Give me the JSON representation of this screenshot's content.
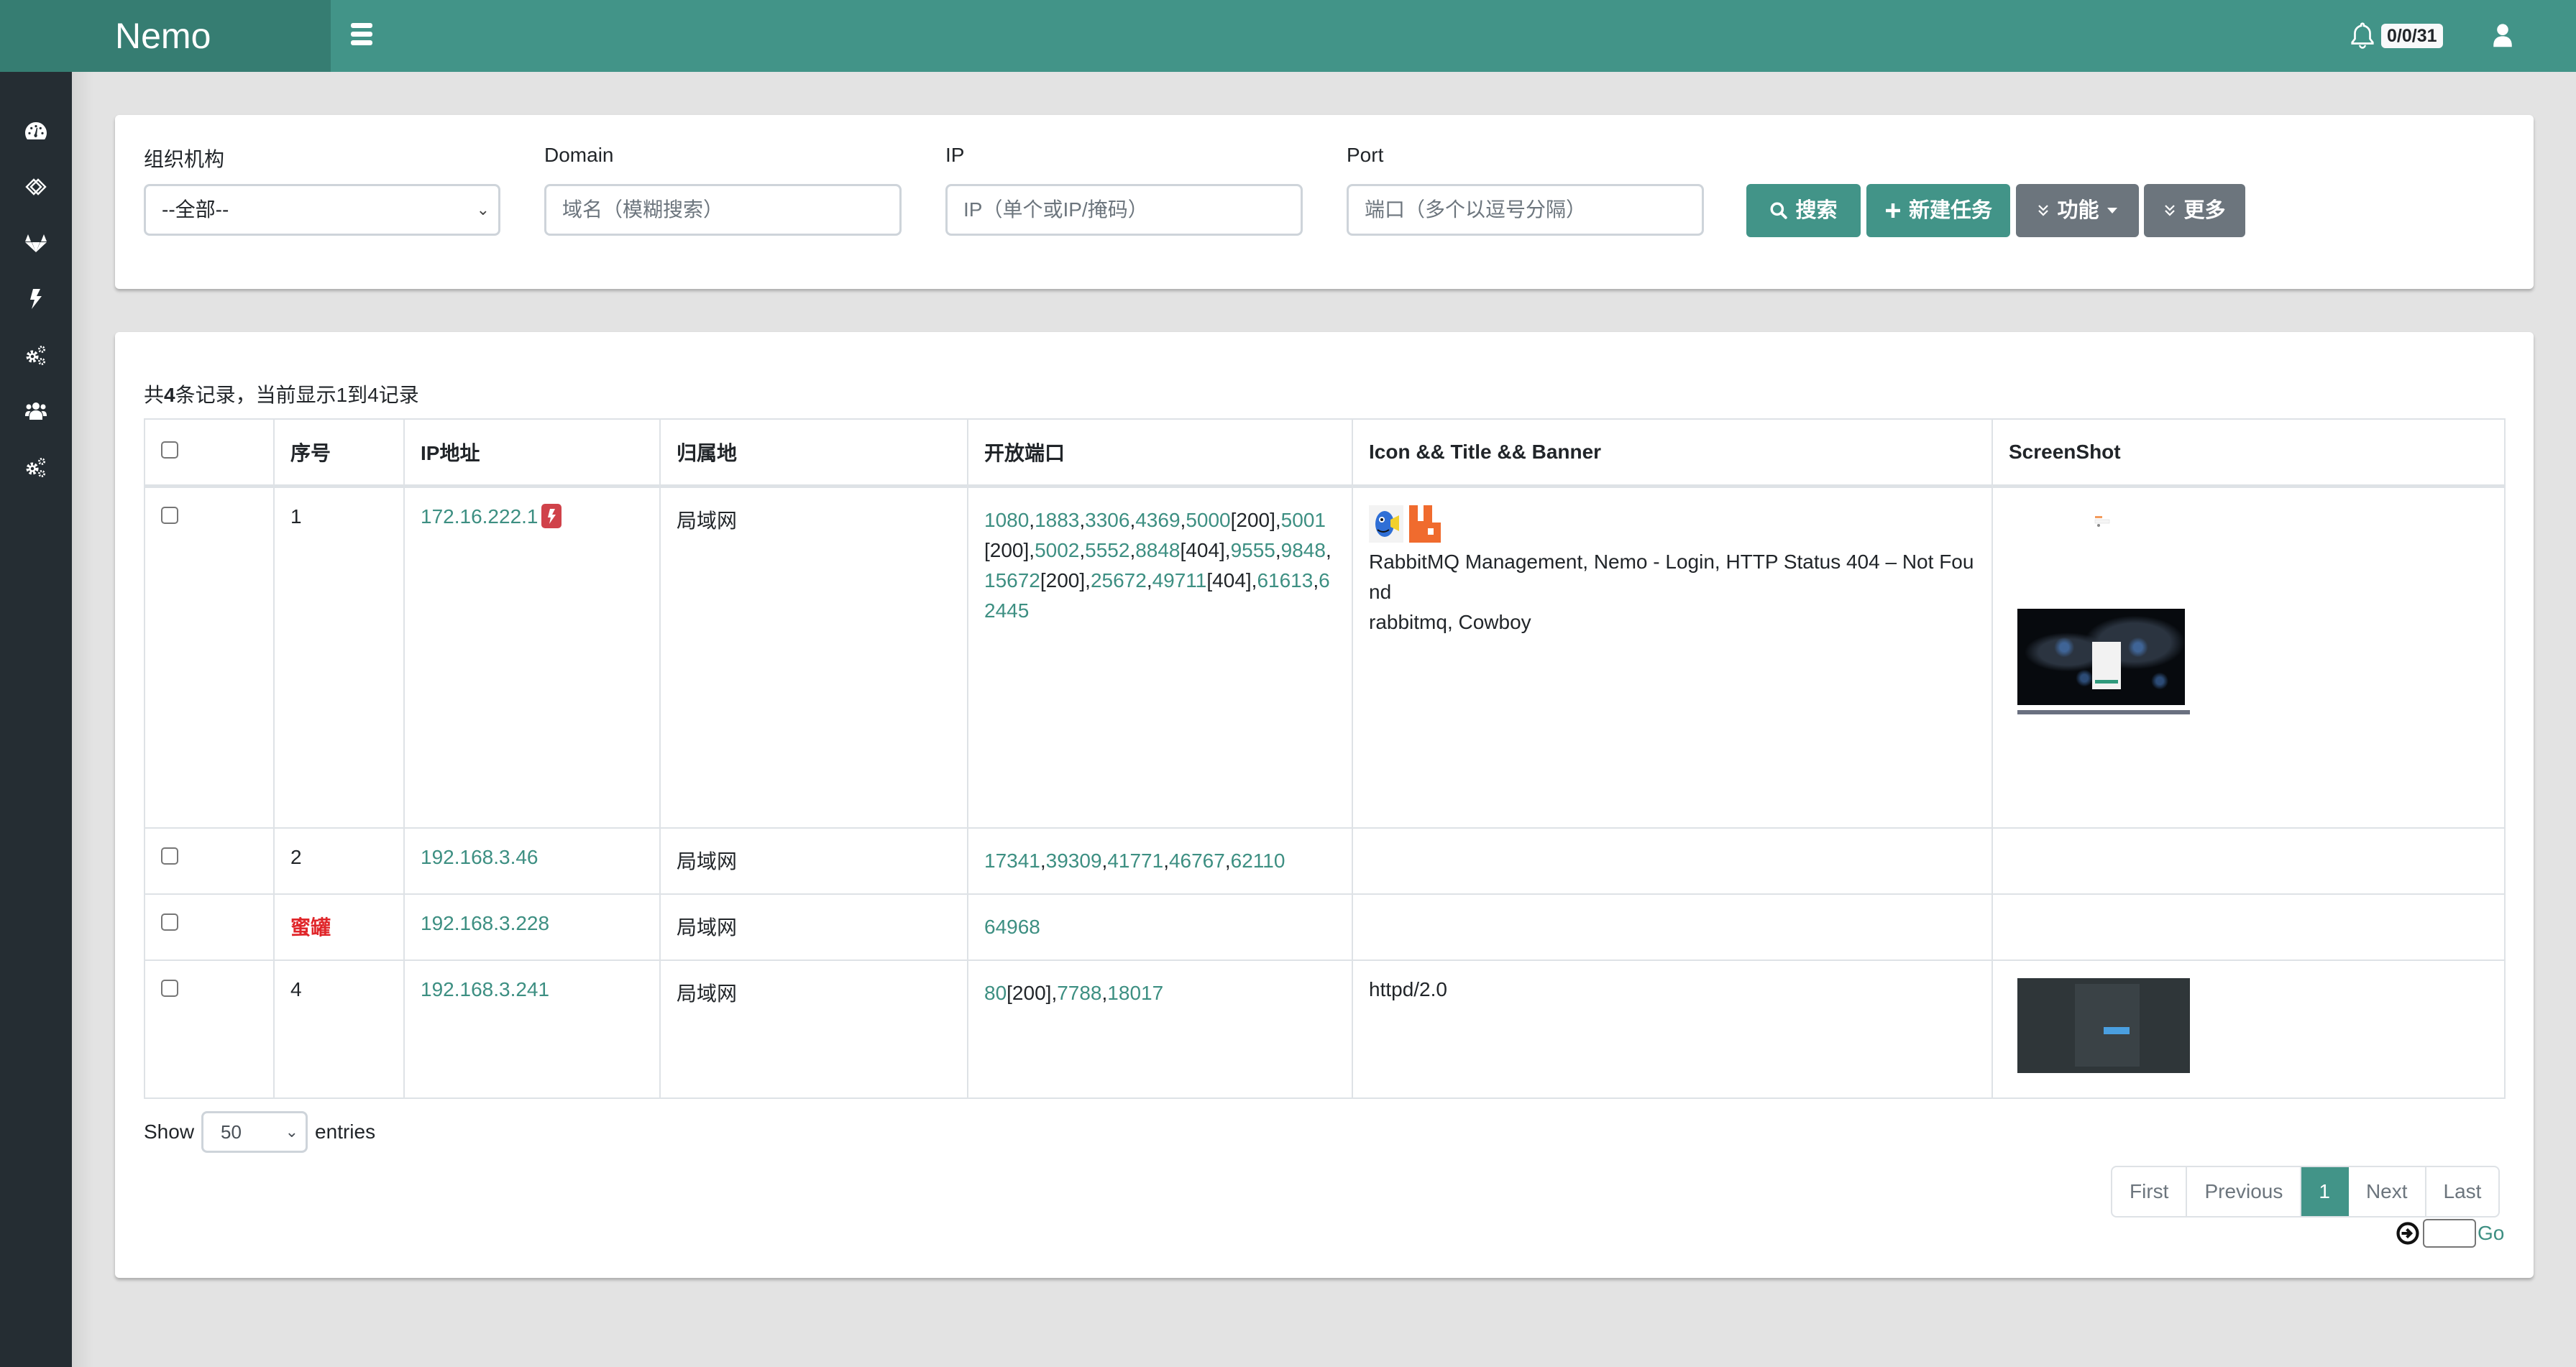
{
  "app": {
    "brand": "Nemo",
    "notification_badge": "0/0/31"
  },
  "colors": {
    "brand": "#429488",
    "brand_dark": "#367d72",
    "sidebar": "#252d33",
    "danger": "#d0424a",
    "secondary": "#6c757d"
  },
  "sidebar": {
    "items": [
      {
        "icon": "tachometer-icon"
      },
      {
        "icon": "link-icon"
      },
      {
        "icon": "gitlab-icon"
      },
      {
        "icon": "bolt-icon"
      },
      {
        "icon": "cogs-icon"
      },
      {
        "icon": "users-icon"
      },
      {
        "icon": "cogs-icon"
      }
    ]
  },
  "search": {
    "org_label": "组织机构",
    "org_value": "--全部--",
    "domain_label": "Domain",
    "domain_placeholder": "域名（模糊搜索）",
    "ip_label": "IP",
    "ip_placeholder": "IP（单个或IP/掩码）",
    "port_label": "Port",
    "port_placeholder": "端口（多个以逗号分隔）",
    "search_button": "搜索",
    "new_task_button": "新建任务",
    "function_button": "功能",
    "more_button": "更多"
  },
  "results": {
    "summary_prefix": "共",
    "summary_total": "4",
    "summary_suffix": "条记录，当前显示1到4记录",
    "columns": [
      "序号",
      "IP地址",
      "归属地",
      "开放端口",
      "Icon && Title && Banner",
      "ScreenShot"
    ],
    "rows": [
      {
        "index": "1",
        "ip": "172.16.222.1",
        "has_flash_badge": true,
        "location": "局域网",
        "ports": [
          {
            "port": "1080"
          },
          {
            "port": "1883"
          },
          {
            "port": "3306"
          },
          {
            "port": "4369"
          },
          {
            "port": "5000",
            "status": "[200]"
          },
          {
            "port": "5001",
            "status": "[200]"
          },
          {
            "port": "5002"
          },
          {
            "port": "5552"
          },
          {
            "port": "8848",
            "status": "[404]"
          },
          {
            "port": "9555"
          },
          {
            "port": "9848"
          },
          {
            "port": "15672",
            "status": "[200]"
          },
          {
            "port": "25672"
          },
          {
            "port": "49711",
            "status": "[404]"
          },
          {
            "port": "61613"
          },
          {
            "port": "62445"
          }
        ],
        "icons": [
          "nemo-favicon",
          "rabbitmq-favicon"
        ],
        "title": "RabbitMQ Management, Nemo - Login, HTTP Status 404 – Not Found",
        "banner": "rabbitmq, Cowboy",
        "screenshots": [
          "rabbitmq-login-thumbnail",
          "nemo-login-thumbnail"
        ]
      },
      {
        "index": "2",
        "ip": "192.168.3.46",
        "location": "局域网",
        "ports": [
          {
            "port": "17341"
          },
          {
            "port": "39309"
          },
          {
            "port": "41771"
          },
          {
            "port": "46767"
          },
          {
            "port": "62110"
          }
        ],
        "title": "",
        "banner": ""
      },
      {
        "index": "蜜罐",
        "index_is_honeypot": true,
        "ip": "192.168.3.228",
        "location": "局域网",
        "ports": [
          {
            "port": "64968"
          }
        ],
        "title": "",
        "banner": ""
      },
      {
        "index": "4",
        "ip": "192.168.3.241",
        "location": "局域网",
        "ports": [
          {
            "port": "80",
            "status": "[200]"
          },
          {
            "port": "7788"
          },
          {
            "port": "18017"
          }
        ],
        "title": "",
        "banner": "httpd/2.0",
        "screenshots": [
          "dark-admin-thumbnail"
        ]
      }
    ]
  },
  "footer": {
    "show_label": "Show",
    "page_size": "50",
    "entries_label": "entries",
    "pagination": {
      "first": "First",
      "previous": "Previous",
      "current": "1",
      "next": "Next",
      "last": "Last"
    },
    "go_label": "Go",
    "goto_value": ""
  }
}
